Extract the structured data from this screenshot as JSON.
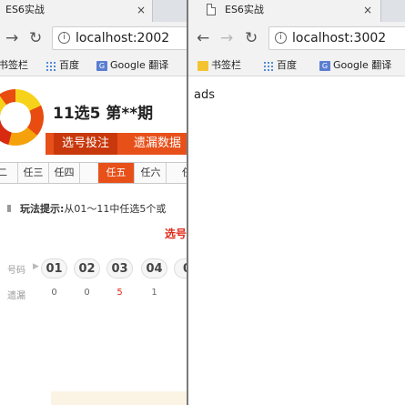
{
  "left": {
    "tab_title": "ES6实战",
    "tab_close": "×",
    "url": "localhost:2002",
    "bookmarks": [
      "书签栏",
      "百度",
      "Google 翻译"
    ],
    "lottery": {
      "title": "11选5 第**期",
      "main_tabs": [
        "选号投注",
        "遗漏数据"
      ],
      "play_tabs": [
        "二",
        "任三",
        "任四",
        "任五",
        "任六",
        "任"
      ],
      "active_play_tab": "任五",
      "hint_label": "玩法提示:",
      "hint_text": "从01～11中任选5个或",
      "select_label": "选号",
      "number_row_label": "号码",
      "numbers": [
        "01",
        "02",
        "03",
        "04",
        "0"
      ],
      "miss_row_label": "遗漏",
      "miss_values": [
        "0",
        "0",
        "5",
        "1",
        ""
      ]
    }
  },
  "right": {
    "tab_title": "ES6实战",
    "tab_close": "×",
    "url": "localhost:3002",
    "bookmarks": [
      "书签栏",
      "百度",
      "Google 翻译"
    ],
    "body_text": "ads"
  },
  "icons": {
    "back": "←",
    "forward": "→",
    "reload": "↻",
    "info": "i"
  }
}
